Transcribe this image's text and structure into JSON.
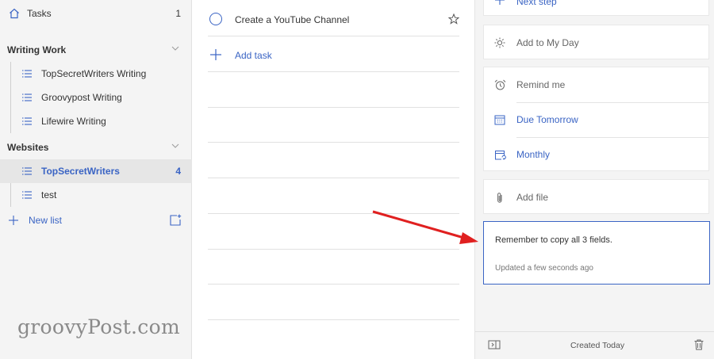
{
  "sidebar": {
    "tasks": {
      "label": "Tasks",
      "count": "1",
      "icon": "home-icon"
    },
    "groups": [
      {
        "label": "Writing Work",
        "items": [
          {
            "label": "TopSecretWriters Writing"
          },
          {
            "label": "Groovypost Writing"
          },
          {
            "label": "Lifewire Writing"
          }
        ]
      },
      {
        "label": "Websites",
        "items": [
          {
            "label": "TopSecretWriters",
            "count": "4",
            "active": true
          },
          {
            "label": "test"
          }
        ]
      }
    ],
    "new_list": {
      "label": "New list"
    }
  },
  "task_list": {
    "tasks": [
      {
        "title": "Create a YouTube Channel",
        "completed": false,
        "important": false
      }
    ],
    "add_task_label": "Add task"
  },
  "details": {
    "next_step_label": "Next step",
    "my_day_label": "Add to My Day",
    "remind_label": "Remind me",
    "due_label": "Due Tomorrow",
    "repeat_label": "Monthly",
    "add_file_label": "Add file",
    "note": {
      "text": "Remember to copy all 3 fields.",
      "updated": "Updated a few seconds ago"
    },
    "footer": {
      "created": "Created Today"
    }
  },
  "watermark": "groovyPost.com",
  "colors": {
    "accent": "#3a64c4",
    "arrow": "#e02020",
    "sidebar_bg": "#f4f4f4"
  }
}
